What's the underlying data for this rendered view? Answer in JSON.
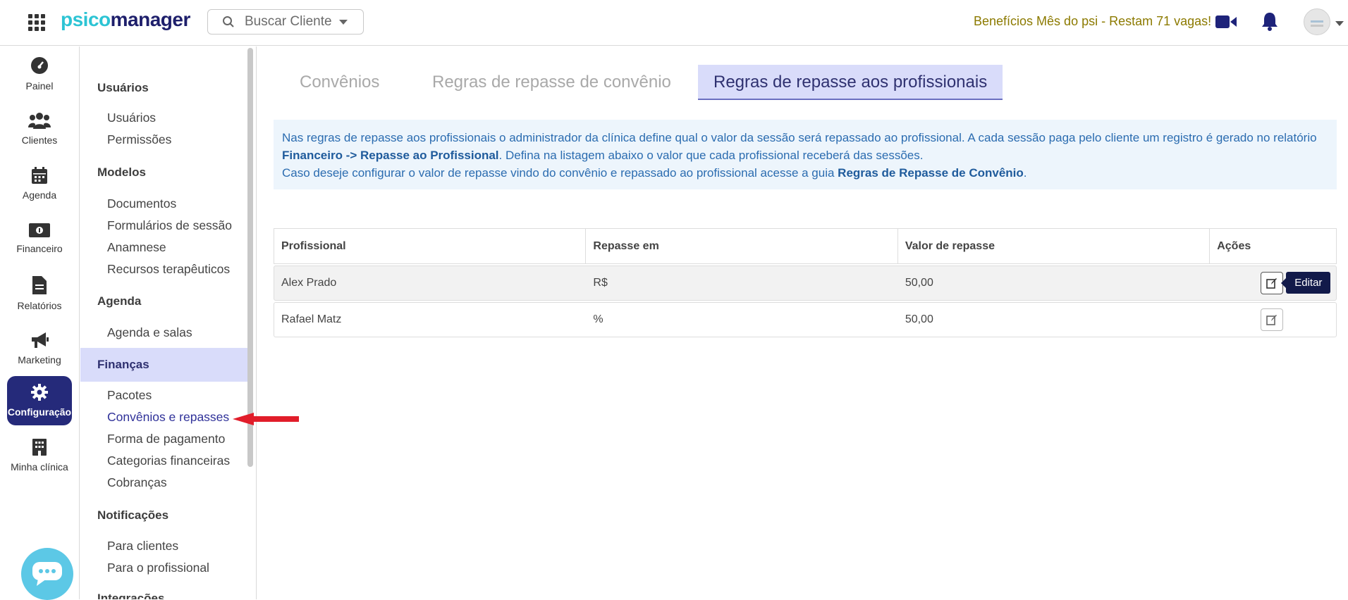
{
  "header": {
    "logo_part1": "psico",
    "logo_part2": "manager",
    "search_placeholder": "Buscar Cliente",
    "promo_text": "Benefícios Mês do psi - Restam 71 vagas!"
  },
  "rail": {
    "items": [
      {
        "label": "Painel",
        "icon": "gauge-icon"
      },
      {
        "label": "Clientes",
        "icon": "users-icon"
      },
      {
        "label": "Agenda",
        "icon": "calendar-icon"
      },
      {
        "label": "Financeiro",
        "icon": "money-icon"
      },
      {
        "label": "Relatórios",
        "icon": "document-icon"
      },
      {
        "label": "Marketing",
        "icon": "megaphone-icon"
      },
      {
        "label": "Configuração",
        "icon": "gear-icon",
        "active": true
      },
      {
        "label": "Minha clínica",
        "icon": "building-icon"
      }
    ]
  },
  "sidebar": {
    "sections": [
      {
        "title": "Usuários",
        "items": [
          "Usuários",
          "Permissões"
        ]
      },
      {
        "title": "Modelos",
        "items": [
          "Documentos",
          "Formulários de sessão",
          "Anamnese",
          "Recursos terapêuticos"
        ]
      },
      {
        "title": "Agenda",
        "items": [
          "Agenda e salas"
        ]
      },
      {
        "title": "Finanças",
        "items": [
          "Pacotes",
          "Convênios e repasses",
          "Forma de pagamento",
          "Categorias financeiras",
          "Cobranças"
        ],
        "active": true,
        "active_item": "Convênios e repasses"
      },
      {
        "title": "Notificações",
        "items": [
          "Para clientes",
          "Para o profissional"
        ]
      },
      {
        "title": "Integrações",
        "items": []
      }
    ]
  },
  "tabs": [
    {
      "label": "Convênios",
      "active": false
    },
    {
      "label": "Regras de repasse de convênio",
      "active": false
    },
    {
      "label": "Regras de repasse aos profissionais",
      "active": true
    }
  ],
  "info": {
    "line1_pre": "Nas regras de repasse aos profissionais o administrador da clínica define qual o valor da sessão será repassado ao profissional. A cada sessão paga pelo cliente um registro é gerado no relatório ",
    "line1_bold": "Financeiro -> Repasse ao Profissional",
    "line1_post": ". Defina na listagem abaixo o valor que cada profissional receberá das sessões.",
    "line2_pre": "Caso deseje configurar o valor de repasse vindo do convênio e repassado ao profissional acesse a guia ",
    "line2_bold": "Regras de Repasse de Convênio",
    "line2_post": "."
  },
  "table": {
    "headers": [
      "Profissional",
      "Repasse em",
      "Valor de repasse",
      "Ações"
    ],
    "rows": [
      {
        "profissional": "Alex Prado",
        "repasse_em": "R$",
        "valor": "50,00"
      },
      {
        "profissional": "Rafael Matz",
        "repasse_em": "%",
        "valor": "50,00"
      }
    ],
    "tooltip": "Editar"
  },
  "colors": {
    "primary": "#252a7a",
    "accent": "#2cc4d4",
    "active_bg": "#d9dcfa",
    "info_bg": "#edf5fc",
    "promo": "#8c7a00"
  }
}
